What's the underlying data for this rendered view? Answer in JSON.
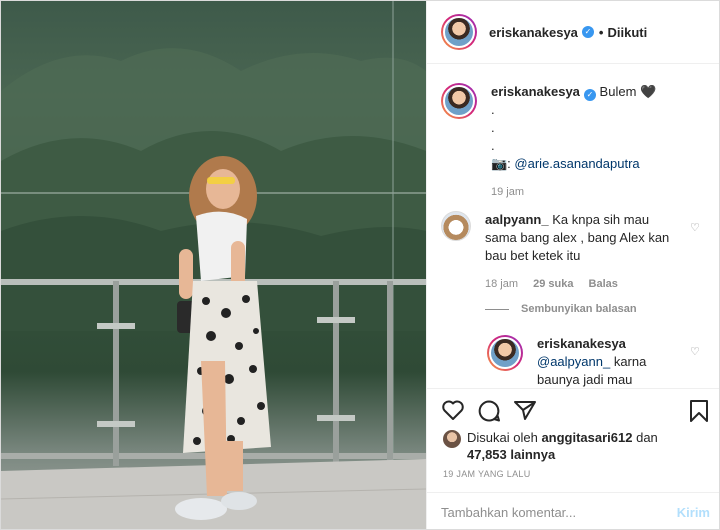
{
  "header": {
    "username": "eriskanakesya",
    "follow_status": "Diikuti"
  },
  "caption": {
    "username": "eriskanakesya",
    "text": "Bulem 🖤",
    "line1": ".",
    "line2": ".",
    "line3": ".",
    "credit_prefix": "📷: ",
    "credit_handle": "@arie.asanandaputra",
    "time": "19 jam"
  },
  "comment": {
    "username": "aalpyann_",
    "text": "Ka knpa sih mau sama bang alex , bang Alex kan bau bet ketek itu",
    "time": "18 jam",
    "likes": "29 suka",
    "reply_label": "Balas",
    "hide_replies": "Sembunyikan balasan"
  },
  "reply": {
    "username": "eriskanakesya",
    "mention": "@aalpyann_",
    "text": " karna baunya jadi mau 🤣"
  },
  "likes": {
    "prefix": "Disukai oleh ",
    "user": "anggitasari612",
    "middle": " dan",
    "count": "47,853 lainnya"
  },
  "timestamp": "19 JAM YANG LALU",
  "add_comment": {
    "placeholder": "Tambahkan komentar...",
    "send_label": "Kirim"
  },
  "colors": {
    "link": "#00376b",
    "verified": "#3897f0",
    "send_disabled": "#b2dffc"
  }
}
